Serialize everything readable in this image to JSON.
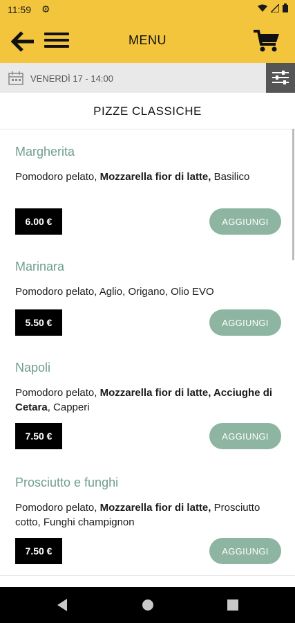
{
  "status_bar": {
    "time": "11:59",
    "icons": [
      "gear-icon",
      "wifi-icon",
      "signal-icon",
      "battery-icon"
    ]
  },
  "app_bar": {
    "title": "MENU",
    "back_icon": "arrow-left-icon",
    "menu_icon": "hamburger-icon",
    "cart_icon": "cart-icon",
    "background": "#F2C53D"
  },
  "date_bar": {
    "text": "VENERDÌ 17 - 14:00",
    "icon": "calendar-icon",
    "filter_icon": "sliders-icon"
  },
  "section": {
    "title": "PIZZE CLASSICHE"
  },
  "items": [
    {
      "name": "Margherita",
      "desc": [
        {
          "text": "Pomodoro pelato, ",
          "bold": false
        },
        {
          "text": "Mozzarella fior di latte,",
          "bold": true
        },
        {
          "text": " Basilico",
          "bold": false
        }
      ],
      "price": "6.00 €",
      "add_label": "AGGIUNGI"
    },
    {
      "name": "Marinara",
      "desc": [
        {
          "text": "Pomodoro pelato, Aglio, Origano, Olio EVO",
          "bold": false
        }
      ],
      "price": "5.50 €",
      "add_label": "AGGIUNGI"
    },
    {
      "name": "Napoli",
      "desc": [
        {
          "text": "Pomodoro pelato, ",
          "bold": false
        },
        {
          "text": "Mozzarella fior di latte, Acciughe di Cetara",
          "bold": true
        },
        {
          "text": ", Capperi",
          "bold": false
        }
      ],
      "price": "7.50 €",
      "add_label": "AGGIUNGI"
    },
    {
      "name": "Prosciutto e funghi",
      "desc": [
        {
          "text": "Pomodoro pelato, ",
          "bold": false
        },
        {
          "text": "Mozzarella fior di latte,",
          "bold": true
        },
        {
          "text": " Prosciutto cotto, Funghi champignon",
          "bold": false
        }
      ],
      "price": "7.50 €",
      "add_label": "AGGIUNGI"
    }
  ],
  "colors": {
    "accent": "#F2C53D",
    "item_name": "#6E9E8A",
    "add_button": "#8DB5A2"
  },
  "nav_bar": {
    "icons": [
      "back-triangle-icon",
      "home-circle-icon",
      "recents-square-icon"
    ]
  }
}
